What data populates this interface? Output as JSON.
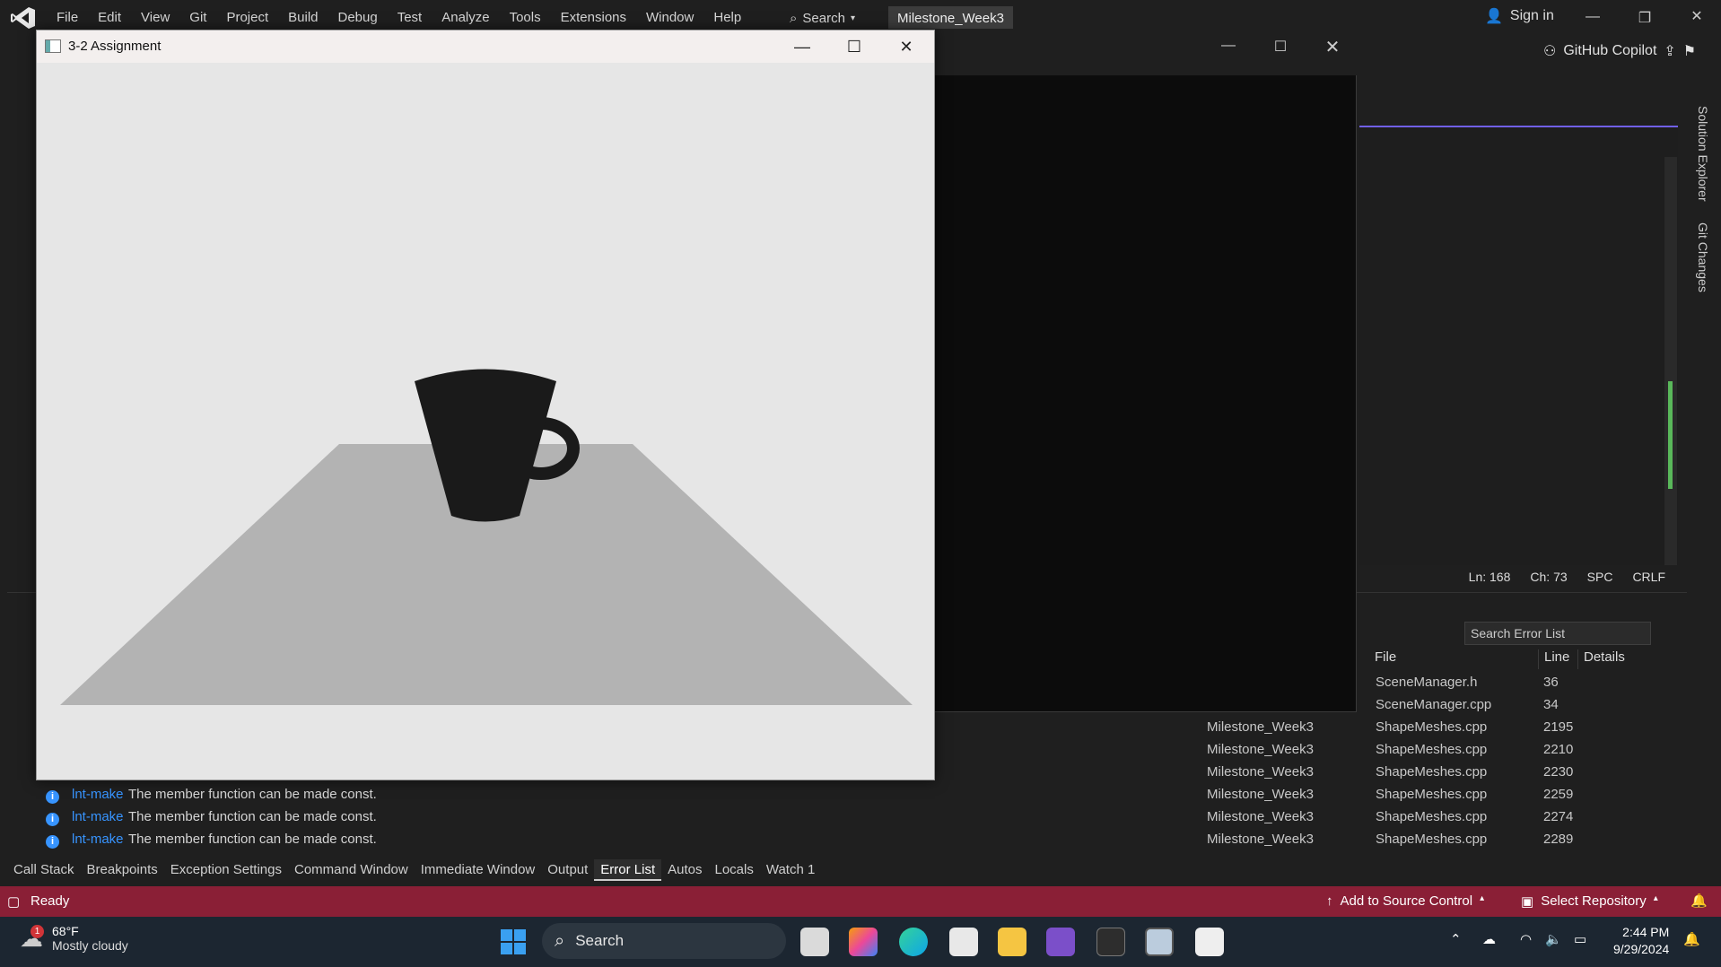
{
  "vs": {
    "menu": [
      "File",
      "Edit",
      "View",
      "Git",
      "Project",
      "Build",
      "Debug",
      "Test",
      "Analyze",
      "Tools",
      "Extensions",
      "Window",
      "Help"
    ],
    "search_label": "Search",
    "solution_tab": "Milestone_Week3",
    "sign_in": "Sign in",
    "copilot": "GitHub Copilot",
    "right_tabs": {
      "solution_explorer": "Solution Explorer",
      "git_changes": "Git Changes"
    }
  },
  "editor_status": {
    "line": "Ln: 168",
    "char": "Ch: 73",
    "spc": "SPC",
    "crlf": "CRLF"
  },
  "error_list": {
    "search_placeholder": "Search Error List",
    "columns": {
      "file": "File",
      "line": "Line",
      "details": "Details"
    },
    "rows": [
      {
        "code": "",
        "desc": "",
        "project": "",
        "file": "SceneManager.h",
        "line": "36"
      },
      {
        "code": "",
        "desc": "",
        "project": "",
        "file": "SceneManager.cpp",
        "line": "34"
      },
      {
        "code": "",
        "desc": "",
        "project": "Milestone_Week3",
        "file": "ShapeMeshes.cpp",
        "line": "2195"
      },
      {
        "code": "",
        "desc": "",
        "project": "Milestone_Week3",
        "file": "ShapeMeshes.cpp",
        "line": "2210"
      },
      {
        "code": "",
        "desc": "",
        "project": "Milestone_Week3",
        "file": "ShapeMeshes.cpp",
        "line": "2230"
      },
      {
        "code": "lnt-make",
        "desc": "The member function can be made const.",
        "project": "Milestone_Week3",
        "file": "ShapeMeshes.cpp",
        "line": "2259"
      },
      {
        "code": "lnt-make",
        "desc": "The member function can be made const.",
        "project": "Milestone_Week3",
        "file": "ShapeMeshes.cpp",
        "line": "2274"
      },
      {
        "code": "lnt-make",
        "desc": "The member function can be made const.",
        "project": "Milestone_Week3",
        "file": "ShapeMeshes.cpp",
        "line": "2289"
      }
    ]
  },
  "tool_tabs": [
    "Call Stack",
    "Breakpoints",
    "Exception Settings",
    "Command Window",
    "Immediate Window",
    "Output",
    "Error List",
    "Autos",
    "Locals",
    "Watch 1"
  ],
  "active_tool_tab": "Error List",
  "statusbar": {
    "ready": "Ready",
    "source_control": "Add to Source Control",
    "repository": "Select Repository",
    "color": "#8a1f36"
  },
  "gl_window": {
    "title": "3-2 Assignment",
    "bg_color": "#e6e6e6",
    "plane_color": "#b3b3b3",
    "mug_color": "#1a1a1a"
  },
  "taskbar": {
    "weather_temp": "68°F",
    "weather_cond": "Mostly cloudy",
    "weather_badge": "1",
    "search": "Search",
    "time": "2:44 PM",
    "date": "9/29/2024"
  }
}
